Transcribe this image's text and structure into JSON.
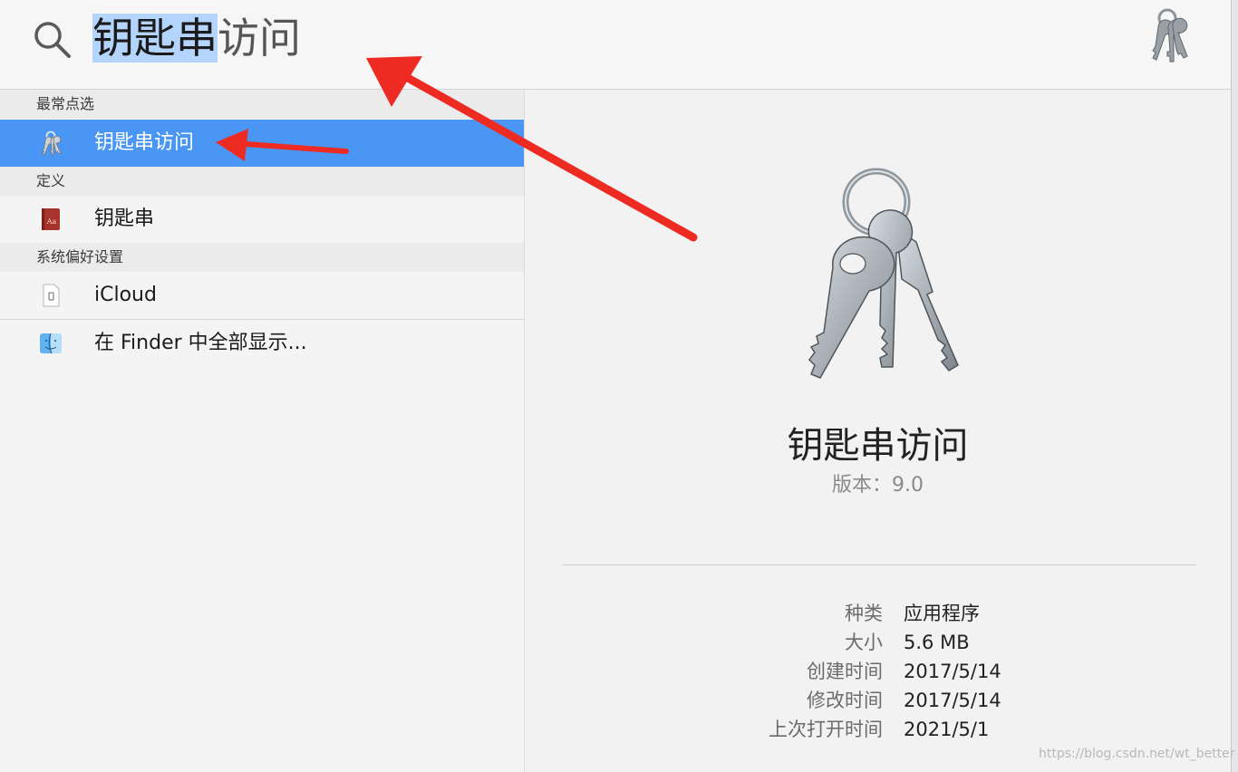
{
  "search": {
    "query_selected": "钥匙串",
    "query_rest": "访问"
  },
  "sections": {
    "top_hit": "最常点选",
    "definition": "定义",
    "system_prefs": "系统偏好设置"
  },
  "results": {
    "top_hit_item": "钥匙串访问",
    "definition_item": "钥匙串",
    "icloud_item": "iCloud",
    "finder_item": "在 Finder 中全部显示..."
  },
  "preview": {
    "title": "钥匙串访问",
    "version": "版本：9.0",
    "info": [
      {
        "key": "种类",
        "value": "应用程序"
      },
      {
        "key": "大小",
        "value": "5.6 MB"
      },
      {
        "key": "创建时间",
        "value": "2017/5/14"
      },
      {
        "key": "修改时间",
        "value": "2017/5/14"
      },
      {
        "key": "上次打开时间",
        "value": "2021/5/1"
      }
    ]
  },
  "watermark": "https://blog.csdn.net/wt_better",
  "colors": {
    "selection_blue": "#4a96f5",
    "text_highlight": "#b3d4fd",
    "arrow_red": "#ee2b23"
  },
  "icons": {
    "search": "magnifier-icon",
    "app": "keychain-icon",
    "dictionary": "dictionary-icon",
    "icloud": "icloud-prefpane-icon",
    "finder": "finder-icon"
  }
}
